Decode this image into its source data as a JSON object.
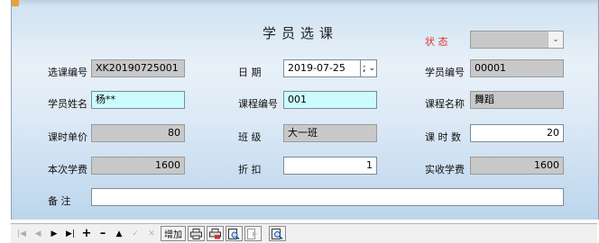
{
  "form": {
    "title": "学员选课",
    "status_label": "状  态",
    "status_value": "",
    "fields": {
      "course_select_no": {
        "label": "选课编号",
        "value": "XK20190725001"
      },
      "date": {
        "label": "日    期",
        "value": "2019-07-25",
        "picker_value": ";"
      },
      "student_no": {
        "label": "学员编号",
        "value": "00001"
      },
      "student_name": {
        "label": "学员姓名",
        "value": "杨**"
      },
      "course_no": {
        "label": "课程编号",
        "value": "001"
      },
      "course_name": {
        "label": "课程名称",
        "value": "舞蹈"
      },
      "unit_price": {
        "label": "课时单价",
        "value": "80"
      },
      "class": {
        "label": "班    级",
        "value": "大一班"
      },
      "lessons": {
        "label": "课 时 数",
        "value": "20"
      },
      "fee": {
        "label": "本次学费",
        "value": "1600"
      },
      "discount": {
        "label": "折    扣",
        "value": "1"
      },
      "paid": {
        "label": "实收学费",
        "value": "1600"
      },
      "remark": {
        "label": "备    注",
        "value": ""
      }
    }
  },
  "toolbar": {
    "add_label": "增加",
    "icons": [
      "first-record-icon",
      "previous-record-icon",
      "next-record-icon",
      "last-record-icon",
      "add-record-icon",
      "delete-record-icon",
      "post-icon",
      "edit-icon",
      "cancel-icon",
      "print-icon",
      "print-red-icon",
      "preview-icon",
      "export-icon",
      "search-icon"
    ]
  },
  "colors": {
    "readonly_bg": "#c8c8c8",
    "input_bg": "#ccfbfd",
    "status_label": "#e03030",
    "accent": "#e8a237"
  }
}
